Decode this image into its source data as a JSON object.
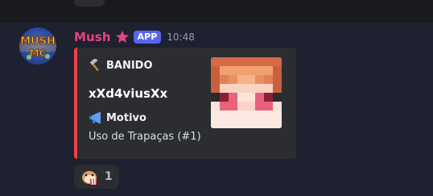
{
  "message": {
    "username": "Mush",
    "app_tag": "APP",
    "timestamp": "10:48",
    "avatar_icon": "mush-logo-avatar",
    "role_icon": "pink-star-icon",
    "colors": {
      "username": "#e9447d",
      "app_tag_bg": "#5865f2",
      "embed_accent": "#ed4245",
      "embed_bg": "#2b2d31",
      "page_bg": "#1f2030"
    }
  },
  "embed": {
    "author_icon": "hammer-icon",
    "author": "BANIDO",
    "title": "xXd4viusXx",
    "field": {
      "icon": "megaphone-icon",
      "name": "Motivo",
      "value": "Uso de Trapaças (#1)"
    },
    "thumbnail": "minecraft-player-head"
  },
  "reaction": {
    "emoji": "hamster-popcorn-emoji",
    "count": "1"
  }
}
